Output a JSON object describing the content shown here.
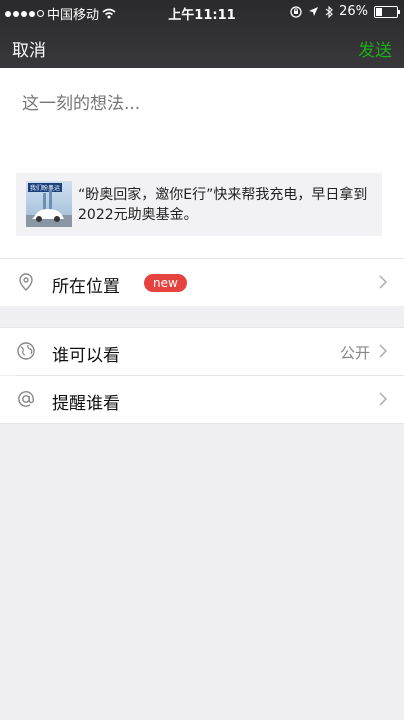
{
  "status_bar": {
    "carrier": "中国移动",
    "time": "上午11:11",
    "battery": "26%"
  },
  "nav": {
    "cancel_label": "取消",
    "send_label": "发送",
    "send_color": "#1aad19"
  },
  "compose": {
    "placeholder": "这一刻的想法...",
    "shared_card": {
      "thumbnail_title": "我们盼奥运",
      "text": "“盼奥回家，邀你E行”快来帮我充电，早日拿到2022元助奥基金。"
    }
  },
  "location": {
    "label": "所在位置",
    "badge": "new",
    "icon": "location-pin-icon"
  },
  "privacy": {
    "label": "谁可以看",
    "value": "公开",
    "icon": "globe-icon"
  },
  "mention": {
    "label": "提醒谁看",
    "icon": "at-icon"
  }
}
